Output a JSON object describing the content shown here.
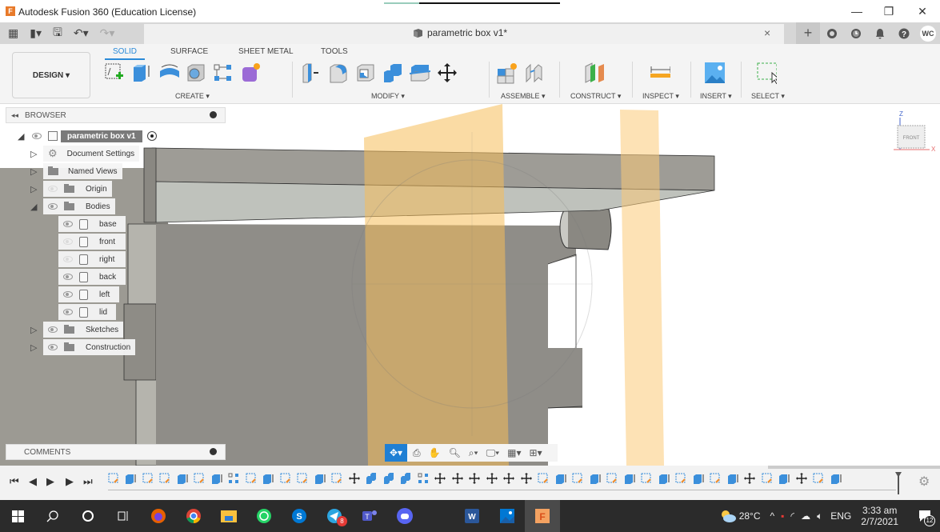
{
  "window": {
    "app_title": "Autodesk Fusion 360 (Education License)",
    "logo_letter": "F",
    "minimize": "—",
    "restore": "❐",
    "close": "✕"
  },
  "app_toolbar": {
    "grid_icon": "▦",
    "file_icon": "▮▾",
    "save_icon": "🖫",
    "undo_icon": "↶▾",
    "redo_icon": "↷▾",
    "doc_title": "parametric box v1*",
    "close_tab": "×",
    "new_tab": "+",
    "avatar": "WC"
  },
  "ribbon": {
    "workspace": "DESIGN ▾",
    "tabs": [
      {
        "label": "SOLID",
        "active": true
      },
      {
        "label": "SURFACE",
        "active": false
      },
      {
        "label": "SHEET METAL",
        "active": false
      },
      {
        "label": "TOOLS",
        "active": false
      }
    ],
    "groups": [
      {
        "label": "CREATE ▾"
      },
      {
        "label": "MODIFY ▾"
      },
      {
        "label": "ASSEMBLE ▾"
      },
      {
        "label": "CONSTRUCT ▾"
      },
      {
        "label": "INSPECT ▾"
      },
      {
        "label": "INSERT ▾"
      },
      {
        "label": "SELECT ▾"
      }
    ]
  },
  "browser": {
    "title": "BROWSER",
    "root": "parametric box v1",
    "items": [
      {
        "label": "Document Settings"
      },
      {
        "label": "Named Views"
      },
      {
        "label": "Origin"
      },
      {
        "label": "Bodies"
      }
    ],
    "bodies": [
      {
        "label": "base",
        "visible": true
      },
      {
        "label": "front",
        "visible": false
      },
      {
        "label": "right",
        "visible": false
      },
      {
        "label": "back",
        "visible": true
      },
      {
        "label": "left",
        "visible": true
      },
      {
        "label": "lid",
        "visible": true
      }
    ],
    "more": [
      {
        "label": "Sketches"
      },
      {
        "label": "Construction"
      }
    ]
  },
  "comments": {
    "title": "COMMENTS"
  },
  "viewcube": {
    "face": "FRONT",
    "axis_z": "Z",
    "axis_x": "X"
  },
  "timeline": {
    "first": "⏮",
    "prev": "◀",
    "play": "▶",
    "next": "▶",
    "last": "⏭",
    "settings": "⚙"
  },
  "taskbar": {
    "weather": "28°C",
    "lang": "ENG",
    "time": "3:33 am",
    "date": "2/7/2021",
    "notifications": "12",
    "telegram_badge": "8"
  }
}
